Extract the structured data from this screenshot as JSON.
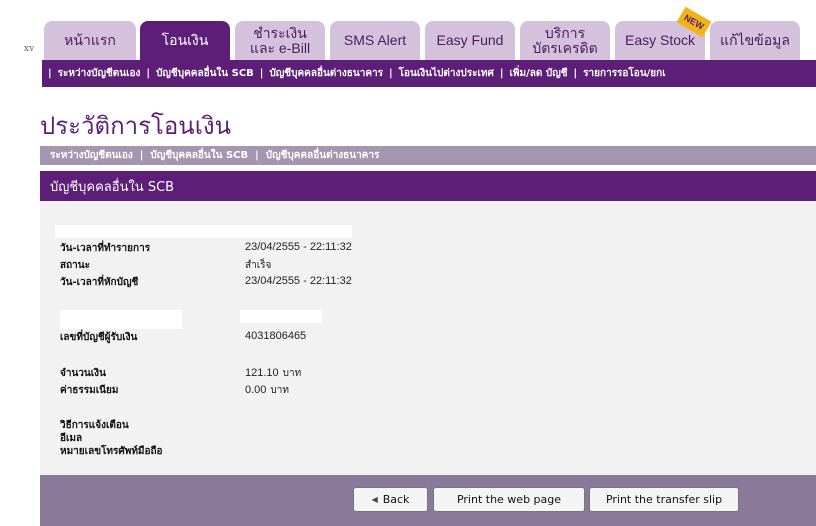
{
  "xv_label": "xv",
  "tabs": [
    {
      "label": "หน้าแรก"
    },
    {
      "label": "โอนเงิน"
    },
    {
      "label": "ชำระเงิน\nและ e-Bill"
    },
    {
      "label": "SMS Alert"
    },
    {
      "label": "Easy Fund"
    },
    {
      "label": "บริการ\nบัตรเครดิต"
    },
    {
      "label": "Easy Stock",
      "badge": "NEW"
    },
    {
      "label": "แก้ไขข้อมูล"
    }
  ],
  "subnav": [
    "ระหว่างบัญชีตนเอง",
    "บัญชีบุคคลอื่นใน SCB",
    "บัญชีบุคคลอื่นต่างธนาคาร",
    "โอนเงินไปต่างประเทศ",
    "เพิ่ม/ลด บัญชี",
    "รายการรอโอน/ยกเ"
  ],
  "page_title": "ประวัติการโอนเงิน",
  "lightbar": [
    "ระหว่างบัญชีตนเอง",
    "บัญชีบุคคลอื่นใน SCB",
    "บัญชีบุคคลอื่นต่างธนาคาร"
  ],
  "section_title": "บัญชีบุคคลอื่นใน SCB",
  "details": {
    "transaction_datetime_label": "วัน-เวลาที่ทำรายการ",
    "transaction_datetime": "23/04/2555 - 22:11:32",
    "status_label": "สถานะ",
    "status": "สำเร็จ",
    "debit_datetime_label": "วัน-เวลาที่หักบัญชี",
    "debit_datetime": "23/04/2555 - 22:11:32",
    "recipient_account_label": "เลขที่บัญชีผู้รับเงิน",
    "recipient_account": "4031806465",
    "amount_label": "จำนวนเงิน",
    "amount": "121.10",
    "amount_unit": "บาท",
    "fee_label": "ค่าธรรมเนียม",
    "fee": "0.00",
    "fee_unit": "บาท",
    "notify_label": "วิธีการแจ้งเตือน",
    "email_label": "อีเมล",
    "phone_label": "หมายเลขโทรศัพท์มือถือ"
  },
  "buttons": {
    "back": "Back",
    "print_page": "Print the web page",
    "print_slip": "Print the transfer slip"
  },
  "colors": {
    "brand_purple": "#5c1e77",
    "tab_inactive": "#d4c2dc",
    "light_bar": "#a495b0",
    "footer": "#8a799a",
    "badge": "#f2b316"
  }
}
